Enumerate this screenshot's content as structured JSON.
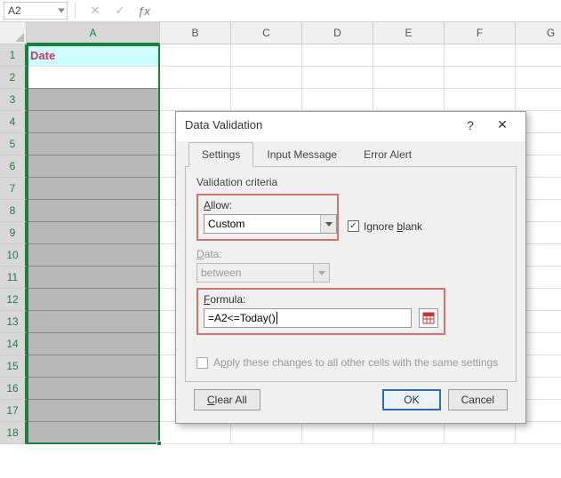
{
  "formula_bar": {
    "name_box": "A2"
  },
  "columns": [
    "A",
    "B",
    "C",
    "D",
    "E",
    "F",
    "G"
  ],
  "rows": [
    1,
    2,
    3,
    4,
    5,
    6,
    7,
    8,
    9,
    10,
    11,
    12,
    13,
    14,
    15,
    16,
    17,
    18
  ],
  "active_cell": "A2",
  "cell_A1": "Date",
  "dialog": {
    "title": "Data Validation",
    "tabs": {
      "settings": "Settings",
      "input": "Input Message",
      "error": "Error Alert"
    },
    "section": "Validation criteria",
    "allow_label": "Allow:",
    "allow_value": "Custom",
    "ignore_blank": "Ignore blank",
    "data_label": "Data:",
    "data_value": "between",
    "formula_label": "Formula:",
    "formula_value": "=A2<=Today()",
    "apply_label": "Apply these changes to all other cells with the same settings",
    "btn_clear": "Clear All",
    "btn_ok": "OK",
    "btn_cancel": "Cancel"
  }
}
